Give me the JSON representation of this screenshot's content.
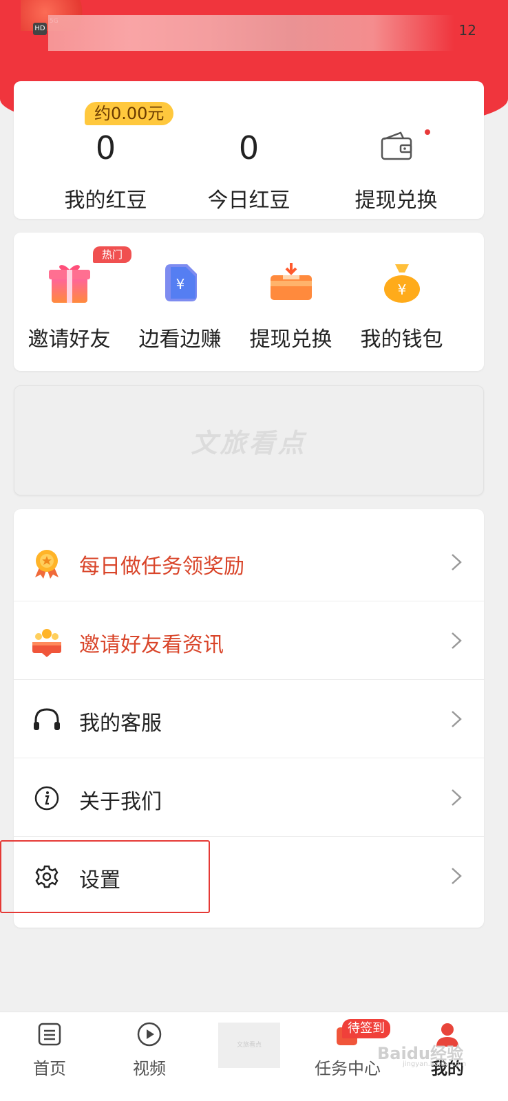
{
  "status_bar": {
    "time": "12"
  },
  "stats": {
    "approx_value": "约0.00元",
    "my_beans": {
      "value": "0",
      "label": "我的红豆"
    },
    "today_beans": {
      "value": "0",
      "label": "今日红豆"
    },
    "withdraw": {
      "label": "提现兑换"
    }
  },
  "quick_actions": {
    "hot_badge": "热门",
    "items": [
      {
        "label": "邀请好友",
        "icon": "gift-icon"
      },
      {
        "label": "边看边赚",
        "icon": "yuan-coin-icon"
      },
      {
        "label": "提现兑换",
        "icon": "withdraw-card-icon"
      },
      {
        "label": "我的钱包",
        "icon": "money-bag-icon"
      }
    ]
  },
  "banner": {
    "text": "文旅看点"
  },
  "menu": {
    "items": [
      {
        "label": "每日做任务领奖励",
        "icon": "medal-icon",
        "accent": "#d9452a"
      },
      {
        "label": "邀请好友看资讯",
        "icon": "group-icon",
        "accent": "#d9452a"
      },
      {
        "label": "我的客服",
        "icon": "headset-icon"
      },
      {
        "label": "关于我们",
        "icon": "info-icon"
      },
      {
        "label": "设置",
        "icon": "gear-icon"
      }
    ]
  },
  "tabbar": {
    "home": "首页",
    "video": "视频",
    "ad_slot_text": "文旅看点",
    "task_center": "任务中心",
    "sign_badge": "待签到",
    "mine": "我的",
    "watermark": "Baidu经验",
    "watermark_sub": "jingyan.baidu.com"
  },
  "colors": {
    "header_red": "#f0353d",
    "accent_red": "#d9452a",
    "pill_yellow": "#ffc83d",
    "highlight_border": "#e53935"
  }
}
